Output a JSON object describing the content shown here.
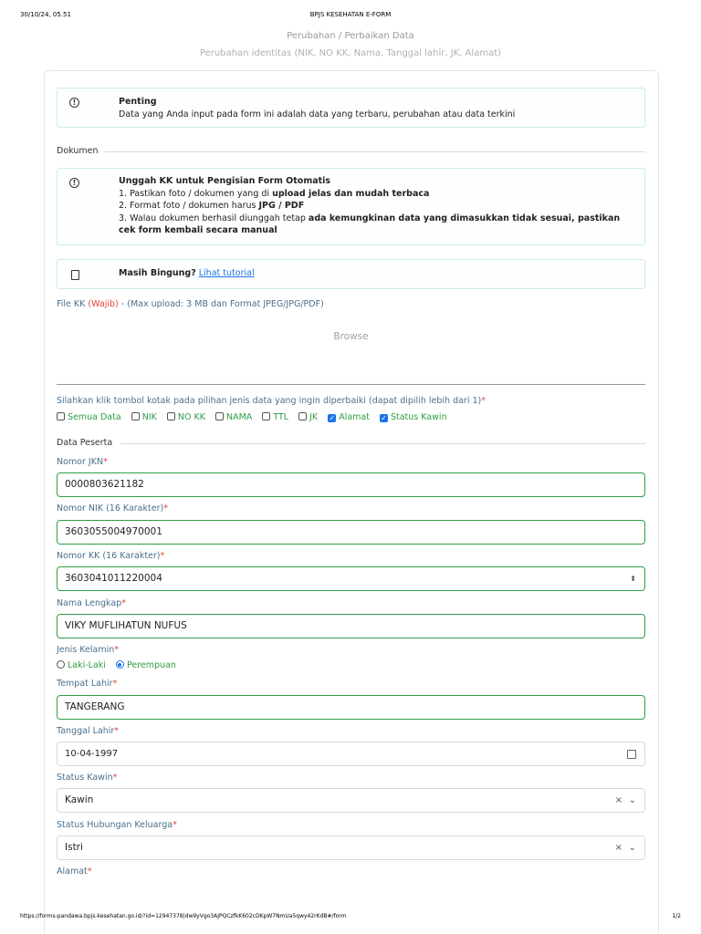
{
  "print": {
    "date": "30/10/24, 05.51",
    "title": "BPJS KESEHATAN E-FORM",
    "url": "https://forms-pandawa.bpjs-kesehatan.go.id/?id=12947378|dw9yVgo3AJPQCzfkK602cDKpW7NmUa5qwy42rKdB#/form",
    "page": "1/2"
  },
  "heading": {
    "title_a": "Perubahan /",
    "title_b": "Perbaikan Data",
    "subtitle": "Perubahan identitas (NIK, NO KK, Nama, Tanggal lahir, JK, Alamat)"
  },
  "alert_penting": {
    "title": "Penting",
    "body": "Data yang Anda input pada form ini adalah data yang terbaru, perubahan atau data terkini"
  },
  "section_dokumen": "Dokumen",
  "alert_unggah": {
    "title": "Unggah KK untuk Pengisian Form Otomatis",
    "line1_a": "1. Pastikan foto / dokumen yang di ",
    "line1_b": "upload jelas dan mudah terbaca",
    "line2_a": "2. Format foto / dokumen harus ",
    "line2_b": "JPG / PDF",
    "line3_a": "3. Walau dokumen berhasil diunggah tetap ",
    "line3_b": "ada kemungkinan data yang dimasukkan tidak sesuai, pastikan cek form kembali secara manual"
  },
  "alert_bingung": {
    "text": "Masih Bingung?",
    "link": "Lihat tutorial"
  },
  "file_kk": {
    "label": "File KK",
    "required": "(Wajib)",
    "hint": "- (Max upload: 3 MB dan Format JPEG/JPG/PDF)",
    "browse": "Browse"
  },
  "pilihan": {
    "instruction": "Silahkan klik tombol kotak pada pilihan jenis data yang ingin diperbaiki (dapat dipilih lebih dari 1)",
    "options": [
      {
        "label": "Semua Data",
        "checked": false
      },
      {
        "label": "NIK",
        "checked": false
      },
      {
        "label": "NO KK",
        "checked": false
      },
      {
        "label": "NAMA",
        "checked": false
      },
      {
        "label": "TTL",
        "checked": false
      },
      {
        "label": "JK",
        "checked": false
      },
      {
        "label": "Alamat",
        "checked": true
      },
      {
        "label": "Status Kawin",
        "checked": true
      }
    ]
  },
  "section_peserta": "Data Peserta",
  "fields": {
    "jkn": {
      "label": "Nomor JKN",
      "value": "0000803621182"
    },
    "nik": {
      "label": "Nomor NIK (16 Karakter)",
      "value": "3603055004970001"
    },
    "kk": {
      "label": "Nomor KK (16 Karakter)",
      "value": "3603041011220004"
    },
    "nama": {
      "label": "Nama Lengkap",
      "value": "VIKY MUFLIHATUN NUFUS"
    },
    "jk": {
      "label": "Jenis Kelamin",
      "opt1": "Laki-Laki",
      "opt2": "Perempuan",
      "selected": "Perempuan"
    },
    "tempat": {
      "label": "Tempat Lahir",
      "value": "TANGERANG"
    },
    "tanggal": {
      "label": "Tanggal Lahir",
      "value": "10-04-1997"
    },
    "status_kawin": {
      "label": "Status Kawin",
      "value": "Kawin"
    },
    "hubungan": {
      "label": "Status Hubungan Keluarga",
      "value": "Istri"
    },
    "alamat": {
      "label": "Alamat"
    }
  },
  "required_mark": "*",
  "colors": {
    "accent_green": "#2f9e44",
    "label_blue": "#4a6f8c",
    "required_red": "#e8423c",
    "link_blue": "#1a73e8"
  }
}
